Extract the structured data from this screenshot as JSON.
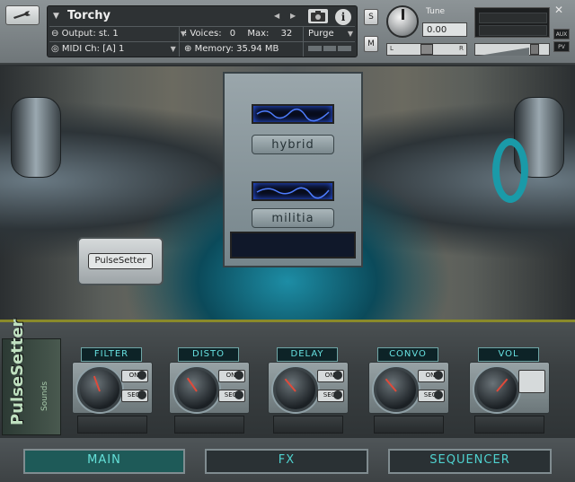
{
  "header": {
    "instrument_name": "Torchy",
    "output_label": "Output:",
    "output_value": "st. 1",
    "midi_label": "MIDI Ch:",
    "midi_value": "[A] 1",
    "voices_label": "Voices:",
    "voices_value": "0",
    "max_label": "Max:",
    "max_value": "32",
    "memory_label": "Memory:",
    "memory_value": "35.94 MB",
    "purge_label": "Purge",
    "info_glyph": "i",
    "solo_label": "S",
    "mute_label": "M",
    "tune_label": "Tune",
    "tune_value": "0.00",
    "pan_left": "L",
    "pan_right": "R",
    "aux_label": "AUX",
    "pv_label": "PV",
    "close_glyph": "✕"
  },
  "artwork": {
    "plate_top": "hybrid",
    "plate_bottom": "militia",
    "pulsesetter_badge": "PulseSetter"
  },
  "rack": {
    "brand_main": "PulseSetter",
    "brand_sub": "Sounds",
    "switch_on": "ON",
    "switch_seq": "SEQ",
    "modules": [
      {
        "label": "FILTER"
      },
      {
        "label": "DISTO"
      },
      {
        "label": "DELAY"
      },
      {
        "label": "CONVO"
      },
      {
        "label": "VOL"
      }
    ]
  },
  "tabs": {
    "main": "MAIN",
    "fx": "FX",
    "sequencer": "SEQUENCER"
  },
  "colors": {
    "accent_cyan": "#4fd2cf",
    "active_tab": "#1e5a58",
    "needle": "#e04a3a"
  }
}
